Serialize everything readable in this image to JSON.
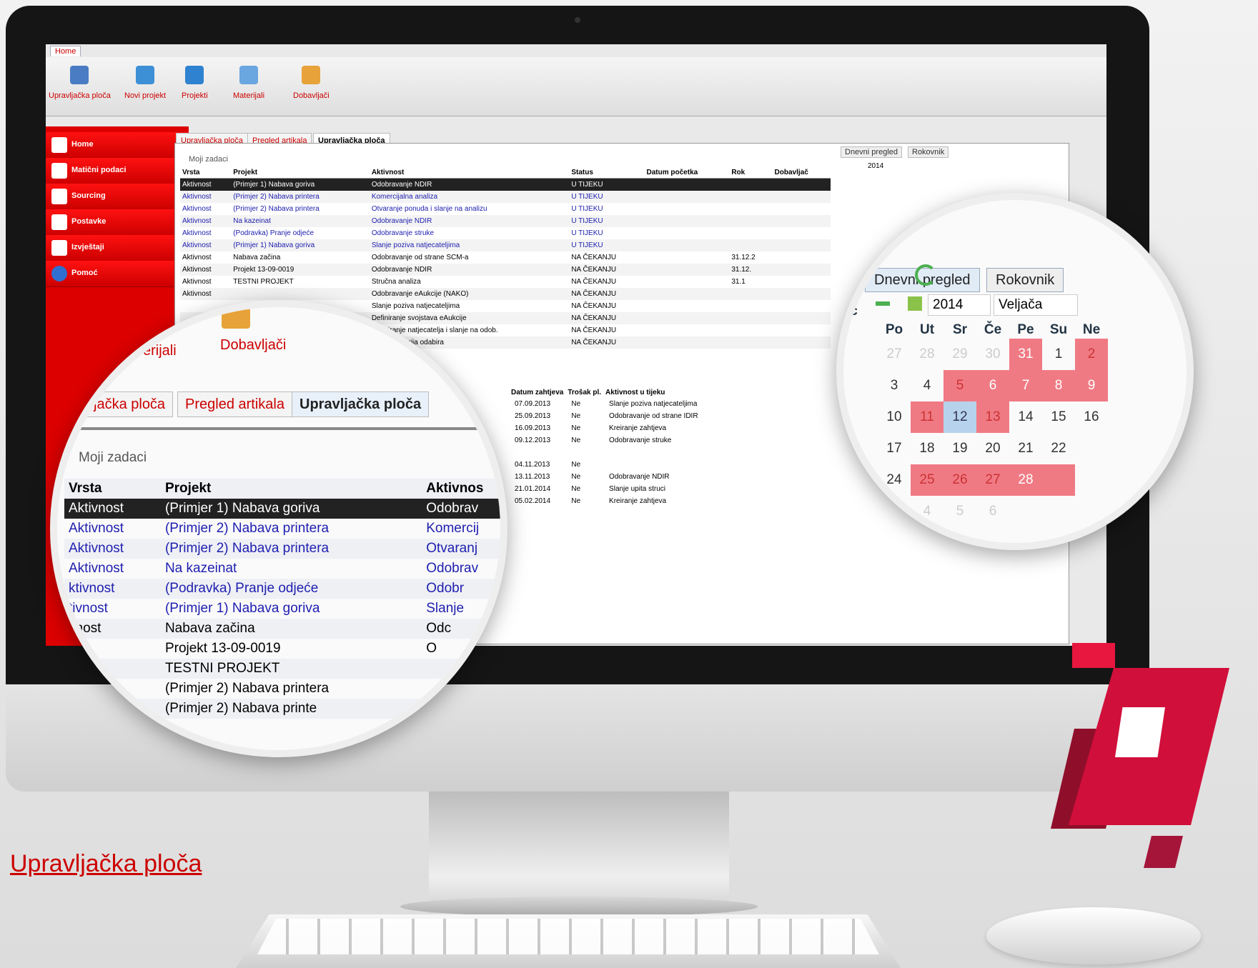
{
  "ribbon": {
    "home_tab": "Home",
    "buttons": [
      {
        "label": "Upravljačka ploča",
        "icon": "dashboard-icon"
      },
      {
        "label": "Novi projekt",
        "icon": "new-project-icon"
      },
      {
        "label": "Projekti",
        "icon": "projects-icon"
      },
      {
        "label": "Materijali",
        "icon": "materials-icon"
      },
      {
        "label": "Dobavljači",
        "icon": "suppliers-icon"
      }
    ]
  },
  "sidebar": {
    "items": [
      {
        "label": "Home",
        "icon": "home-icon"
      },
      {
        "label": "Matični podaci",
        "icon": "master-data-icon"
      },
      {
        "label": "Sourcing",
        "icon": "sourcing-icon"
      },
      {
        "label": "Postavke",
        "icon": "settings-icon"
      },
      {
        "label": "Izvještaji",
        "icon": "reports-icon"
      },
      {
        "label": "Pomoć",
        "icon": "help-icon"
      }
    ]
  },
  "doc_tabs": [
    "Upravljačka ploča",
    "Pregled artikala",
    "Upravljačka ploča"
  ],
  "tasks": {
    "title": "Moji zadaci",
    "columns": [
      "Vrsta",
      "Projekt",
      "Aktivnost",
      "Status",
      "Datum početka",
      "Rok",
      "Dobavljač"
    ],
    "rows": [
      [
        "Aktivnost",
        "(Primjer 1) Nabava goriva",
        "Odobravanje NDIR",
        "U TIJEKU",
        "",
        ""
      ],
      [
        "Aktivnost",
        "(Primjer 2) Nabava printera",
        "Komercijalna analiza",
        "U TIJEKU",
        "",
        ""
      ],
      [
        "Aktivnost",
        "(Primjer 2) Nabava printera",
        "Otvaranje ponuda i slanje na analizu",
        "U TIJEKU",
        "",
        ""
      ],
      [
        "Aktivnost",
        "Na kazeinat",
        "Odobravanje NDIR",
        "U TIJEKU",
        "",
        ""
      ],
      [
        "Aktivnost",
        "(Podravka) Pranje odjeće",
        "Odobravanje struke",
        "U TIJEKU",
        "",
        ""
      ],
      [
        "Aktivnost",
        "(Primjer 1) Nabava goriva",
        "Slanje poziva natjecateljima",
        "U TIJEKU",
        "",
        ""
      ],
      [
        "Aktivnost",
        "Nabava začina",
        "Odobravanje od strane SCM-a",
        "NA ČEKANJU",
        "",
        "31.12.2"
      ],
      [
        "Aktivnost",
        "Projekt 13-09-0019",
        "Odobravanje NDIR",
        "NA ČEKANJU",
        "",
        "31.12."
      ],
      [
        "Aktivnost",
        "TESTNI PROJEKT",
        "Stručna analiza",
        "NA ČEKANJU",
        "",
        "31.1"
      ],
      [
        "Aktivnost",
        "",
        "Odobravanje eAukcije (NAKO)",
        "NA ČEKANJU",
        "",
        ""
      ],
      [
        "",
        "",
        "Slanje poziva natjecateljima",
        "NA ČEKANJU",
        "",
        ""
      ],
      [
        "",
        "",
        "Definiranje svojstava eAukcije",
        "NA ČEKANJU",
        "",
        ""
      ],
      [
        "",
        "",
        "Definiranje natjecatelja i slanje na odob.",
        "NA ČEKANJU",
        "",
        ""
      ],
      [
        "",
        "",
        "niranje kriterija odabira",
        "NA ČEKANJU",
        "",
        ""
      ]
    ],
    "row_styles": [
      "sel",
      "blue",
      "blue",
      "blue",
      "blue",
      "blue",
      "",
      "",
      "",
      "",
      "",
      "",
      "",
      ""
    ]
  },
  "requests": {
    "columns": [
      "Datum zahtjeva",
      "Trošak pl.",
      "Aktivnost u tijeku"
    ],
    "rows": [
      [
        "07.09.2013",
        "Ne",
        "Slanje poziva natjecateljima"
      ],
      [
        "25.09.2013",
        "Ne",
        "Odobravanje od strane IDIR"
      ],
      [
        "16.09.2013",
        "Ne",
        "Kreiranje zahtjeva"
      ],
      [
        "09.12.2013",
        "Ne",
        "Odobravanje struke"
      ],
      [
        "",
        "",
        ""
      ],
      [
        "04.11.2013",
        "Ne",
        ""
      ],
      [
        "13.11.2013",
        "Ne",
        "Odobravanje NDIR"
      ],
      [
        "21.01.2014",
        "Ne",
        "Slanje upita struci"
      ],
      [
        "05.02.2014",
        "Ne",
        "Kreiranje zahtjeva"
      ]
    ]
  },
  "calendar_tabs": [
    "Dnevni pregled",
    "Rokovnik"
  ],
  "calendar": {
    "year": "2014",
    "month": "Veljača",
    "column_header": "Dobavljač",
    "days": [
      "Po",
      "Ut",
      "Sr",
      "Če",
      "Pe",
      "Su",
      "Ne"
    ],
    "weeks": [
      [
        "27",
        "28",
        "29",
        "30",
        "31",
        "1",
        "2"
      ],
      [
        "3",
        "4",
        "5",
        "6",
        "7",
        "8",
        "9"
      ],
      [
        "10",
        "11",
        "12",
        "13",
        "14",
        "15",
        "16"
      ],
      [
        "17",
        "18",
        "19",
        "20",
        "21",
        "22",
        ""
      ],
      [
        "24",
        "25",
        "26",
        "27",
        "28",
        "",
        ""
      ],
      [
        "3",
        "4",
        "5",
        "6",
        "",
        "",
        ""
      ]
    ],
    "styles": [
      [
        "mute",
        "mute",
        "mute",
        "mute",
        "hl",
        "",
        "hl2"
      ],
      [
        "",
        "",
        "hl2",
        "hl",
        "hl",
        "hl",
        "hl"
      ],
      [
        "",
        "hl2",
        "today",
        "hl2",
        "",
        "",
        ""
      ],
      [
        "",
        "",
        "",
        "",
        "",
        "",
        ""
      ],
      [
        "",
        "hl2",
        "hl2",
        "hl2",
        "hl",
        "hl",
        ""
      ],
      [
        "mute",
        "mute",
        "mute",
        "mute",
        "",
        "",
        ""
      ]
    ]
  },
  "magnifier": {
    "tabs": [
      "jačka ploča",
      "Pregled artikala",
      "Upravljačka ploča"
    ],
    "ribbon_labels": [
      "erijali",
      "Dobavljači"
    ],
    "title": "Moji zadaci",
    "columns": [
      "Vrsta",
      "Projekt",
      "Aktivnos"
    ],
    "rows": [
      [
        "Aktivnost",
        "(Primjer 1) Nabava goriva",
        "Odobrav"
      ],
      [
        "Aktivnost",
        "(Primjer 2) Nabava printera",
        "Komercij"
      ],
      [
        "Aktivnost",
        "(Primjer 2) Nabava printera",
        "Otvaranj"
      ],
      [
        "Aktivnost",
        "Na kazeinat",
        "Odobrav"
      ],
      [
        "ktivnost",
        "(Podravka) Pranje odjeće",
        "Odobr"
      ],
      [
        "tivnost",
        "(Primjer 1) Nabava goriva",
        "Slanje"
      ],
      [
        "vnost",
        "Nabava začina",
        "Odc"
      ],
      [
        "ost",
        "Projekt 13-09-0019",
        "O"
      ],
      [
        "",
        "TESTNI PROJEKT",
        ""
      ],
      [
        "",
        "(Primjer 2) Nabava printera",
        ""
      ],
      [
        "",
        "(Primjer 2) Nabava printe",
        ""
      ]
    ],
    "row_styles": [
      "sel",
      "blue",
      "blue",
      "blue",
      "blue",
      "blue",
      "",
      "",
      "",
      "",
      ""
    ]
  },
  "caption": "Upravljačka ploča",
  "colors": {
    "accent": "#dd0000",
    "brand": "#d10f3b",
    "selection": "#222222",
    "link": "#2020b0"
  }
}
